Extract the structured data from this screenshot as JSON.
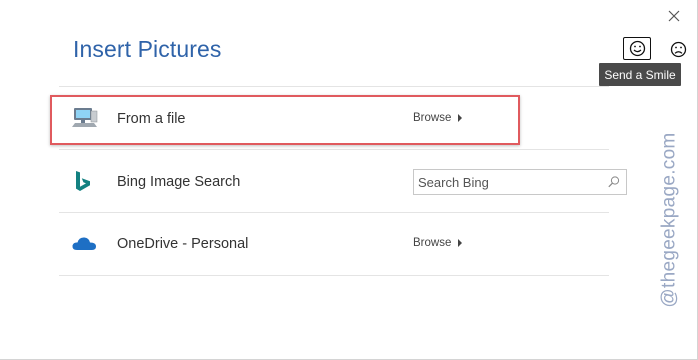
{
  "dialog": {
    "title": "Insert Pictures"
  },
  "feedback": {
    "smile_tooltip": "Send a Smile",
    "smile_icon": "smile-icon",
    "frown_icon": "frown-icon"
  },
  "rows": [
    {
      "label": "From a file",
      "icon": "computer-icon",
      "action": "Browse"
    },
    {
      "label": "Bing Image Search",
      "icon": "bing-icon",
      "search_placeholder": "Search Bing"
    },
    {
      "label": "OneDrive - Personal",
      "icon": "onedrive-icon",
      "action": "Browse"
    }
  ],
  "watermark": "@thegeekpage.com",
  "colors": {
    "title": "#2f63a9",
    "highlight": "#e05a5e",
    "bing": "#138181",
    "onedrive": "#1e6fc4",
    "tooltip_bg": "#4a4a4a"
  }
}
